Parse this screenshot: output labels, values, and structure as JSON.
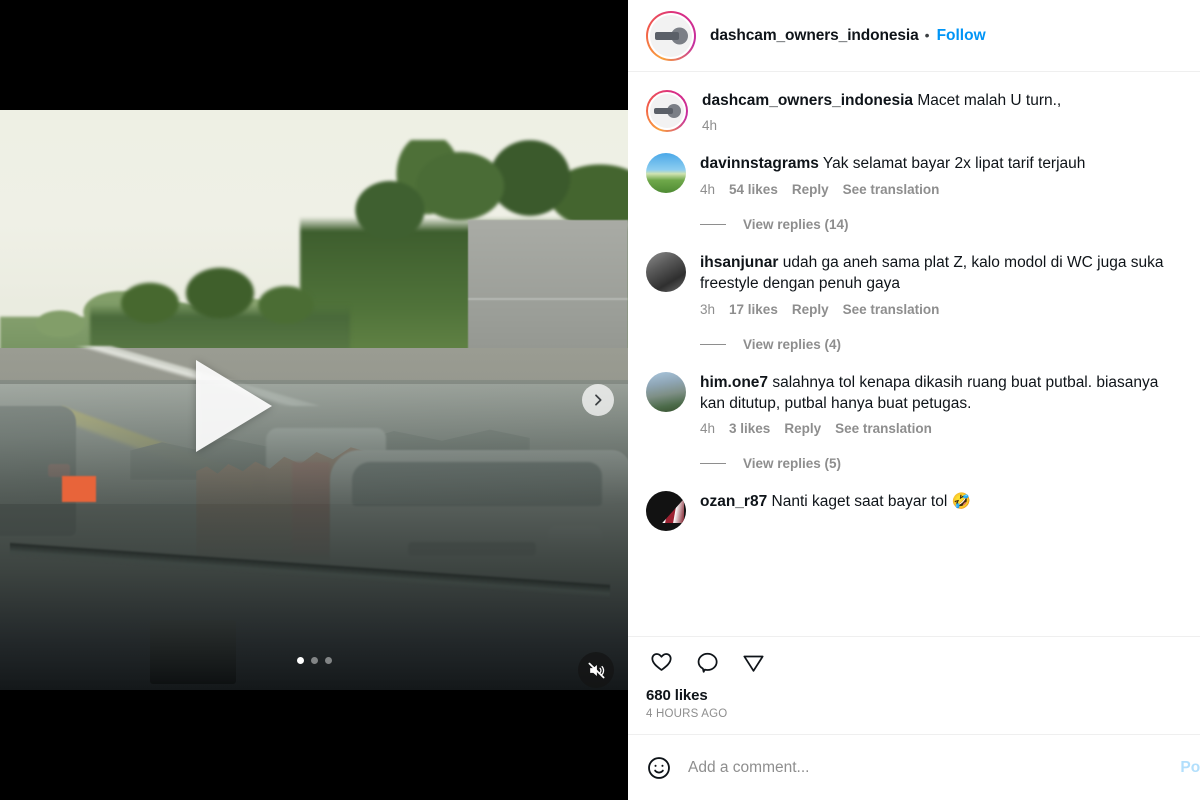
{
  "header": {
    "username": "dashcam_owners_indonesia",
    "separator": "•",
    "follow_label": "Follow",
    "avatar_icon": "profile-logo-icon"
  },
  "media": {
    "play_icon": "play-icon",
    "next_icon": "chevron-right-icon",
    "mute_icon": "speaker-muted-icon",
    "carousel_dots": 3,
    "active_dot_index": 0
  },
  "caption": {
    "username": "dashcam_owners_indonesia",
    "text": "Macet malah U turn.,",
    "time": "4h"
  },
  "comments": [
    {
      "username": "davinnstagrams",
      "text": "Yak selamat bayar 2x lipat tarif terjauh",
      "time": "4h",
      "likes": "54 likes",
      "reply_label": "Reply",
      "translate_label": "See translation",
      "avatar": "landscape-photo-avatar",
      "replies_label": "View replies (14)"
    },
    {
      "username": "ihsanjunar",
      "text": "udah ga aneh sama plat Z, kalo modol di WC juga suka freestyle dengan penuh gaya",
      "time": "3h",
      "likes": "17 likes",
      "reply_label": "Reply",
      "translate_label": "See translation",
      "avatar": "street-photo-avatar",
      "replies_label": "View replies (4)"
    },
    {
      "username": "him.one7",
      "text": "salahnya tol kenapa dikasih ruang buat putbal. biasanya kan ditutup, putbal hanya buat petugas.",
      "time": "4h",
      "likes": "3 likes",
      "reply_label": "Reply",
      "translate_label": "See translation",
      "avatar": "city-photo-avatar",
      "replies_label": "View replies (5)"
    },
    {
      "username": "ozan_r87",
      "text": "Nanti kaget saat bayar tol 🤣",
      "avatar": "dark-graphic-avatar"
    }
  ],
  "actions": {
    "like_icon": "heart-icon",
    "comment_icon": "comment-bubble-icon",
    "share_icon": "share-paperplane-icon",
    "likes_count": "680 likes",
    "posted_time": "4 HOURS AGO"
  },
  "comment_input": {
    "emoji_icon": "smiley-face-icon",
    "placeholder": "Add a comment...",
    "value": "",
    "post_label": "Post"
  },
  "colors": {
    "link_blue": "#0095f6",
    "muted_grey": "#8e8e8e",
    "text_black": "#0f1419",
    "post_disabled_blue": "#b2dffc"
  }
}
